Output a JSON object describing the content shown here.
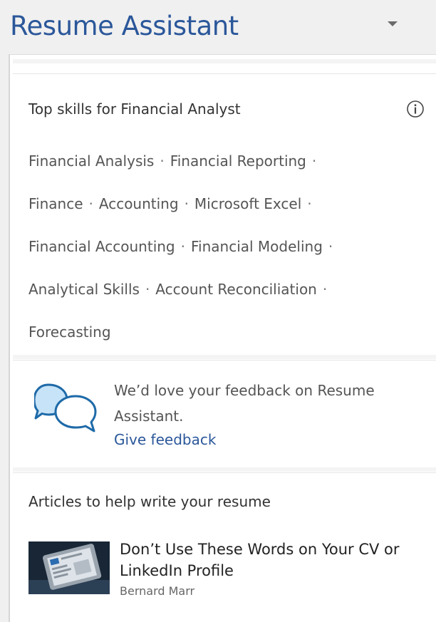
{
  "header": {
    "title": "Resume Assistant",
    "menu_icon": "chevron-down-icon"
  },
  "skills": {
    "title": "Top skills for Financial Analyst",
    "info_icon": "info-icon",
    "separator": "·",
    "items": [
      "Financial Analysis",
      "Financial Reporting",
      "Finance",
      "Accounting",
      "Microsoft Excel",
      "Financial Accounting",
      "Financial Modeling",
      "Analytical Skills",
      "Account Reconciliation",
      "Forecasting"
    ]
  },
  "feedback": {
    "icon": "speech-bubbles-icon",
    "message": "We’d love your feedback on Resume Assistant.",
    "link": "Give feedback"
  },
  "articles": {
    "title": "Articles to help write your resume",
    "items": [
      {
        "title": "Don’t Use These Words on Your CV or LinkedIn Profile",
        "author": "Bernard Marr"
      }
    ]
  },
  "colors": {
    "brand_blue": "#2b579a",
    "icon_blue": "#1e6aa8",
    "text_dark": "#333333",
    "text_muted": "#555555",
    "pane_bg": "#f0f0f0"
  }
}
